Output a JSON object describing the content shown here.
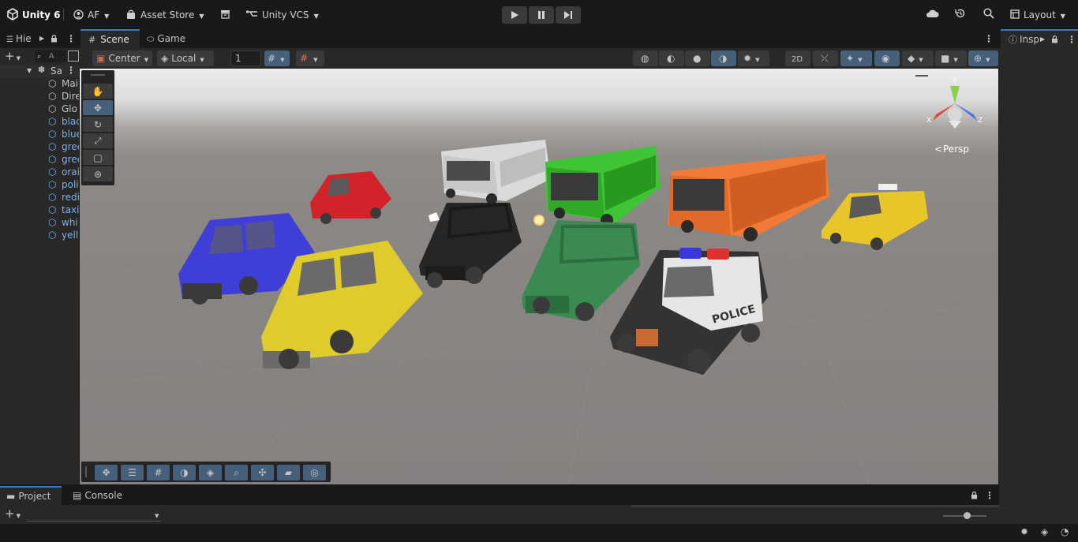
{
  "topbar": {
    "app_title": "Unity 6",
    "account": "AF",
    "asset_store": "Asset Store",
    "vcs": "Unity VCS",
    "layout": "Layout"
  },
  "panels": {
    "hierarchy_tab": "Hie",
    "scene_tab": "Scene",
    "game_tab": "Game",
    "inspector_tab": "Insp",
    "project_tab": "Project",
    "console_tab": "Console"
  },
  "hierarchy": {
    "search_placeholder": "A",
    "scene_name": "Sa",
    "items": [
      "Mai",
      "Dire",
      "Glo",
      "blac",
      "blue",
      "gree",
      "gree",
      "orai",
      "poli",
      "redi",
      "taxi",
      "whi",
      "yell"
    ]
  },
  "scene_toolbar": {
    "pivot_mode": "Center",
    "pivot_rotation": "Local",
    "grid_snap_value": "1"
  },
  "viewport": {
    "projection_label": "Persp",
    "gizmo_axes": {
      "x": "X",
      "y": "Y",
      "z": "Z"
    },
    "police_text": "POLICE"
  },
  "colors": {
    "accent": "#3a79bb",
    "selected_button": "#46607c",
    "hierarchy_prefab_text": "#7bb0ec",
    "panel_bg": "#282828",
    "chrome_bg": "#191919"
  },
  "icons": [
    "unity-logo-icon",
    "account-icon",
    "shop-bag-icon",
    "archive-icon",
    "branch-icon",
    "play-icon",
    "pause-icon",
    "step-icon",
    "cloud-icon",
    "history-icon",
    "search-icon",
    "layout-icon",
    "hand-icon",
    "move-icon",
    "rotate-icon",
    "scale-icon",
    "rect-icon",
    "transform-icon",
    "lock-icon",
    "kebab-menu-icon",
    "plus-icon",
    "gizmo-icon"
  ]
}
